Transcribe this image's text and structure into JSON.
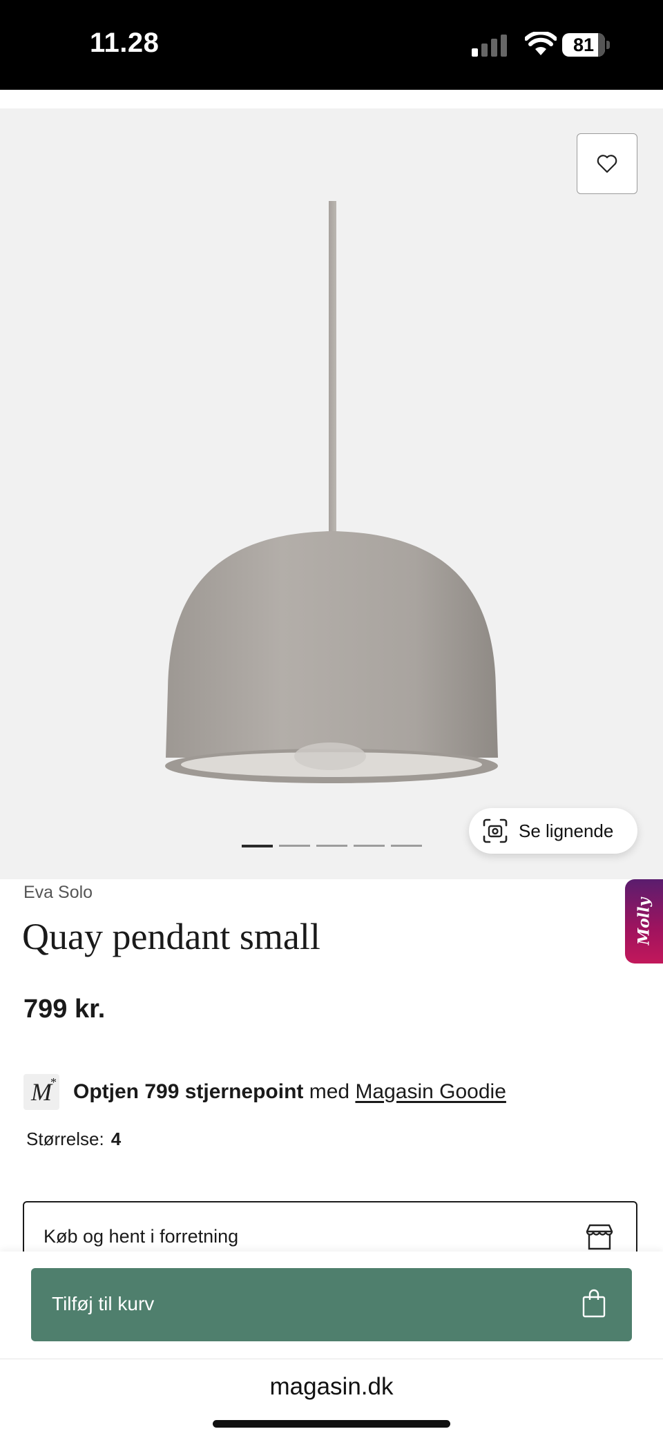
{
  "status_bar": {
    "time": "11.28",
    "battery": "81"
  },
  "gallery": {
    "similar_label": "Se lignende",
    "slide_count": 5,
    "active_slide": 1
  },
  "molly_label": "Molly",
  "product": {
    "brand": "Eva Solo",
    "title": "Quay pendant small",
    "price": "799 kr."
  },
  "goodie": {
    "logo_text": "M",
    "logo_star": "*",
    "bold_text": "Optjen 799 stjernepoint",
    "middle_text": " med ",
    "link_text": "Magasin Goodie"
  },
  "size": {
    "label": "Størrelse:",
    "value": "4"
  },
  "pickup": {
    "label": "Køb og hent i forretning"
  },
  "cart": {
    "label": "Tilføj til kurv"
  },
  "browser": {
    "url": "magasin.dk"
  },
  "colors": {
    "cart_button": "#4f7f6d",
    "gallery_bg": "#f1f1f1"
  }
}
